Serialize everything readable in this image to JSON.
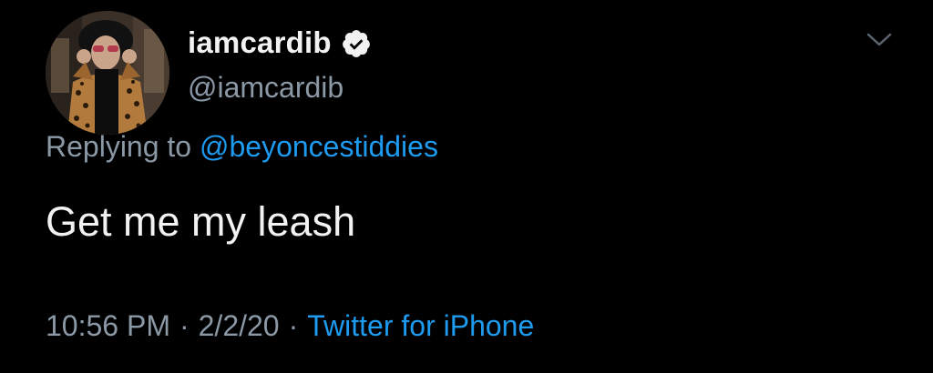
{
  "author": {
    "display_name": "iamcardib",
    "handle": "@iamcardib",
    "verified": true
  },
  "reply": {
    "prefix": "Replying to",
    "mention": "@beyoncestiddies"
  },
  "tweet": {
    "text": "Get me my leash"
  },
  "meta": {
    "time": "10:56 PM",
    "separator": "·",
    "date": "2/2/20",
    "source": "Twitter for iPhone"
  },
  "icons": {
    "verified": "verified-badge-icon",
    "more": "chevron-down-icon"
  },
  "colors": {
    "background": "#000000",
    "primary_text": "#f2f2f2",
    "secondary_text": "#8b98a5",
    "link": "#1d9bf0"
  }
}
